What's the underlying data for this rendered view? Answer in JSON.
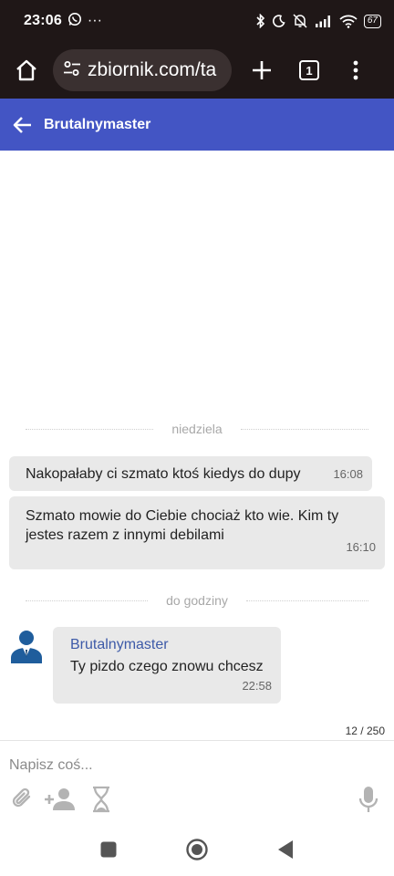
{
  "status_bar": {
    "time": "23:06",
    "dots": "···",
    "battery": "67"
  },
  "browser": {
    "url": "zbiornik.com/ta",
    "tab_count": "1"
  },
  "header": {
    "title": "Brutalnymaster"
  },
  "separators": {
    "first": "niedziela",
    "second": "do godziny"
  },
  "messages": [
    {
      "text": "Nakopałaby ci szmato ktoś kiedys do dupy",
      "time": "16:08"
    },
    {
      "text": "Szmato mowie do Ciebie chociaż kto wie. Kim ty jestes razem z innymi debilami",
      "time": "16:10"
    },
    {
      "sender": "Brutalnymaster",
      "text": "Ty pizdo czego znowu chcesz",
      "time": "22:58"
    }
  ],
  "composer": {
    "char_count": "12 / 250",
    "placeholder": "Napisz coś..."
  },
  "colors": {
    "header_bg": "#4355c4",
    "browser_bg": "#1f1717",
    "bubble_bg": "#e9e9e9",
    "sender_name": "#3d5aa8"
  },
  "icons": [
    "whatsapp-icon",
    "bluetooth-icon",
    "moon-icon",
    "mute-icon",
    "signal-icon",
    "wifi-icon",
    "home-icon",
    "site-settings-icon",
    "plus-icon",
    "menu-icon",
    "back-arrow-icon",
    "attach-icon",
    "add-person-icon",
    "hourglass-icon",
    "mic-icon"
  ]
}
